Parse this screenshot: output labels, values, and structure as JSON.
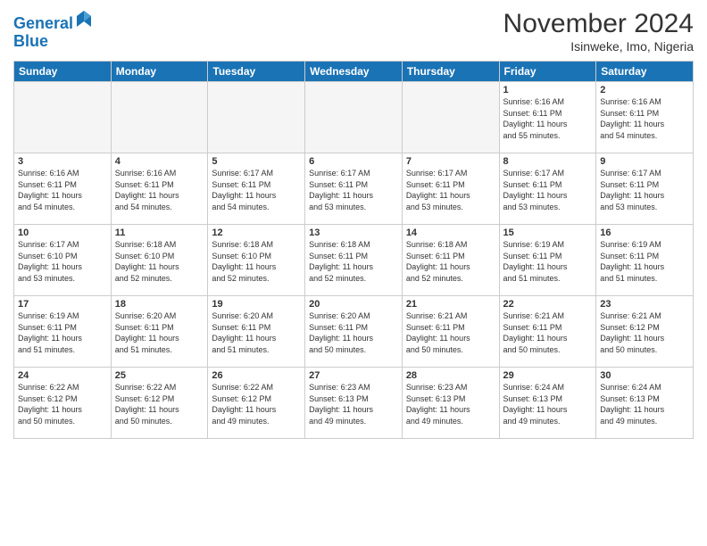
{
  "header": {
    "logo_line1": "General",
    "logo_line2": "Blue",
    "month_title": "November 2024",
    "subtitle": "Isinweke, Imo, Nigeria"
  },
  "weekdays": [
    "Sunday",
    "Monday",
    "Tuesday",
    "Wednesday",
    "Thursday",
    "Friday",
    "Saturday"
  ],
  "weeks": [
    [
      {
        "day": "",
        "info": ""
      },
      {
        "day": "",
        "info": ""
      },
      {
        "day": "",
        "info": ""
      },
      {
        "day": "",
        "info": ""
      },
      {
        "day": "",
        "info": ""
      },
      {
        "day": "1",
        "info": "Sunrise: 6:16 AM\nSunset: 6:11 PM\nDaylight: 11 hours\nand 55 minutes."
      },
      {
        "day": "2",
        "info": "Sunrise: 6:16 AM\nSunset: 6:11 PM\nDaylight: 11 hours\nand 54 minutes."
      }
    ],
    [
      {
        "day": "3",
        "info": "Sunrise: 6:16 AM\nSunset: 6:11 PM\nDaylight: 11 hours\nand 54 minutes."
      },
      {
        "day": "4",
        "info": "Sunrise: 6:16 AM\nSunset: 6:11 PM\nDaylight: 11 hours\nand 54 minutes."
      },
      {
        "day": "5",
        "info": "Sunrise: 6:17 AM\nSunset: 6:11 PM\nDaylight: 11 hours\nand 54 minutes."
      },
      {
        "day": "6",
        "info": "Sunrise: 6:17 AM\nSunset: 6:11 PM\nDaylight: 11 hours\nand 53 minutes."
      },
      {
        "day": "7",
        "info": "Sunrise: 6:17 AM\nSunset: 6:11 PM\nDaylight: 11 hours\nand 53 minutes."
      },
      {
        "day": "8",
        "info": "Sunrise: 6:17 AM\nSunset: 6:11 PM\nDaylight: 11 hours\nand 53 minutes."
      },
      {
        "day": "9",
        "info": "Sunrise: 6:17 AM\nSunset: 6:11 PM\nDaylight: 11 hours\nand 53 minutes."
      }
    ],
    [
      {
        "day": "10",
        "info": "Sunrise: 6:17 AM\nSunset: 6:10 PM\nDaylight: 11 hours\nand 53 minutes."
      },
      {
        "day": "11",
        "info": "Sunrise: 6:18 AM\nSunset: 6:10 PM\nDaylight: 11 hours\nand 52 minutes."
      },
      {
        "day": "12",
        "info": "Sunrise: 6:18 AM\nSunset: 6:10 PM\nDaylight: 11 hours\nand 52 minutes."
      },
      {
        "day": "13",
        "info": "Sunrise: 6:18 AM\nSunset: 6:11 PM\nDaylight: 11 hours\nand 52 minutes."
      },
      {
        "day": "14",
        "info": "Sunrise: 6:18 AM\nSunset: 6:11 PM\nDaylight: 11 hours\nand 52 minutes."
      },
      {
        "day": "15",
        "info": "Sunrise: 6:19 AM\nSunset: 6:11 PM\nDaylight: 11 hours\nand 51 minutes."
      },
      {
        "day": "16",
        "info": "Sunrise: 6:19 AM\nSunset: 6:11 PM\nDaylight: 11 hours\nand 51 minutes."
      }
    ],
    [
      {
        "day": "17",
        "info": "Sunrise: 6:19 AM\nSunset: 6:11 PM\nDaylight: 11 hours\nand 51 minutes."
      },
      {
        "day": "18",
        "info": "Sunrise: 6:20 AM\nSunset: 6:11 PM\nDaylight: 11 hours\nand 51 minutes."
      },
      {
        "day": "19",
        "info": "Sunrise: 6:20 AM\nSunset: 6:11 PM\nDaylight: 11 hours\nand 51 minutes."
      },
      {
        "day": "20",
        "info": "Sunrise: 6:20 AM\nSunset: 6:11 PM\nDaylight: 11 hours\nand 50 minutes."
      },
      {
        "day": "21",
        "info": "Sunrise: 6:21 AM\nSunset: 6:11 PM\nDaylight: 11 hours\nand 50 minutes."
      },
      {
        "day": "22",
        "info": "Sunrise: 6:21 AM\nSunset: 6:11 PM\nDaylight: 11 hours\nand 50 minutes."
      },
      {
        "day": "23",
        "info": "Sunrise: 6:21 AM\nSunset: 6:12 PM\nDaylight: 11 hours\nand 50 minutes."
      }
    ],
    [
      {
        "day": "24",
        "info": "Sunrise: 6:22 AM\nSunset: 6:12 PM\nDaylight: 11 hours\nand 50 minutes."
      },
      {
        "day": "25",
        "info": "Sunrise: 6:22 AM\nSunset: 6:12 PM\nDaylight: 11 hours\nand 50 minutes."
      },
      {
        "day": "26",
        "info": "Sunrise: 6:22 AM\nSunset: 6:12 PM\nDaylight: 11 hours\nand 49 minutes."
      },
      {
        "day": "27",
        "info": "Sunrise: 6:23 AM\nSunset: 6:13 PM\nDaylight: 11 hours\nand 49 minutes."
      },
      {
        "day": "28",
        "info": "Sunrise: 6:23 AM\nSunset: 6:13 PM\nDaylight: 11 hours\nand 49 minutes."
      },
      {
        "day": "29",
        "info": "Sunrise: 6:24 AM\nSunset: 6:13 PM\nDaylight: 11 hours\nand 49 minutes."
      },
      {
        "day": "30",
        "info": "Sunrise: 6:24 AM\nSunset: 6:13 PM\nDaylight: 11 hours\nand 49 minutes."
      }
    ]
  ]
}
